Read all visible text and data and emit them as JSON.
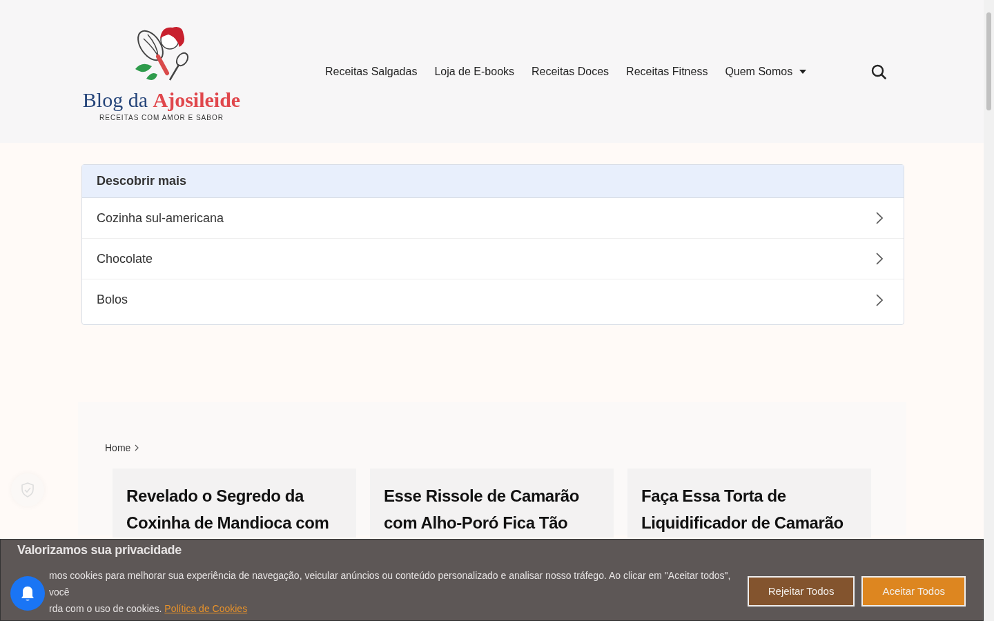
{
  "logo": {
    "title_part1": "Blog da",
    "title_part2": "Ajosileide",
    "tagline": "RECEITAS COM AMOR E SABOR"
  },
  "nav": {
    "items": [
      {
        "label": "Receitas Salgadas",
        "has_dropdown": false
      },
      {
        "label": "Loja de E-books",
        "has_dropdown": false
      },
      {
        "label": "Receitas Doces",
        "has_dropdown": false
      },
      {
        "label": "Receitas Fitness",
        "has_dropdown": false
      },
      {
        "label": "Quem Somos",
        "has_dropdown": true
      }
    ]
  },
  "discover": {
    "title": "Descobrir mais",
    "items": [
      "Cozinha sul-americana",
      "Chocolate",
      "Bolos"
    ]
  },
  "breadcrumb": [
    "Home"
  ],
  "posts": [
    {
      "title": "Revelado o Segredo da Coxinha de Mandioca com"
    },
    {
      "title": "Esse Rissole de Camarão com Alho-Poró Fica Tão"
    },
    {
      "title": "Faça Essa Torta de Liquidificador de Camarão"
    }
  ],
  "cookie_banner": {
    "title": "Valorizamos sua privacidade",
    "text_line1": "mos cookies para melhorar sua experiência de navegação, veicular anúncios ou conteúdo personalizado e analisar nosso tráfego. Ao clicar em \"Aceitar todos\", você",
    "text_line2": "rda com o uso de cookies.",
    "link": "Política de Cookies",
    "buttons": [
      {
        "label": "Rejeitar Todos",
        "kind": "reject"
      },
      {
        "label": "Aceitar Todos",
        "kind": "accept"
      }
    ]
  }
}
